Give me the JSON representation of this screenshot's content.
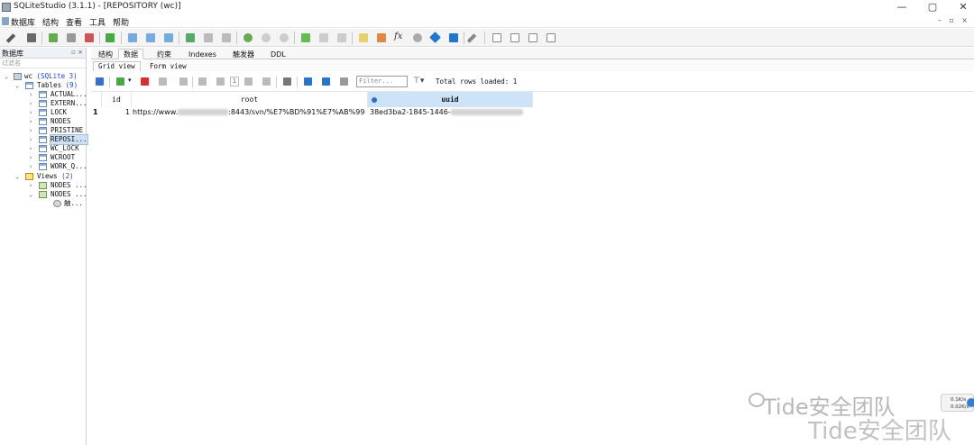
{
  "window": {
    "title": "SQLiteStudio (3.1.1) - [REPOSITORY (wc)]"
  },
  "menu": [
    "数据库",
    "结构",
    "查看",
    "工具",
    "帮助"
  ],
  "db_panel": {
    "title": "数据库",
    "filter_placeholder": "过滤名",
    "db_name": "wc",
    "db_type": "(SQLite 3)",
    "tables_label": "Tables",
    "tables_count": "(9)",
    "tables": [
      "ACTUAL...",
      "EXTERN...",
      "LOCK",
      "NODES",
      "PRISTINE",
      "REPOSI...",
      "WC_LOCK",
      "WCROOT",
      "WORK_Q..."
    ],
    "selected_table": "REPOSI...",
    "views_label": "Views",
    "views_count": "(2)",
    "views": [
      "NODES ...",
      "NODES ..."
    ],
    "trigger_label": "触..."
  },
  "tabs": [
    "结构",
    "数据",
    "约束",
    "Indexes",
    "触发器",
    "DDL"
  ],
  "active_tab": "数据",
  "subtabs": [
    "Grid view",
    "Form view"
  ],
  "active_subtab": "Grid view",
  "data_toolbar": {
    "page": "1",
    "filter_placeholder": "Filter...",
    "total_rows": "Total rows loaded: 1"
  },
  "grid": {
    "columns": [
      "id",
      "root",
      "uuid"
    ],
    "selected_column": "uuid",
    "rows": [
      {
        "rownum": "1",
        "id": "1",
        "root_prefix": "https://www.",
        "root_suffix": ":8443/svn/%E7%BD%91%E7%AB%99",
        "uuid_prefix": "38ed3ba2-1845-1446-"
      }
    ]
  },
  "watermark": "Tide安全团队",
  "net_widget": {
    "up": "0.1K/s",
    "down": "0.02K/s"
  },
  "colors": {
    "selection": "#cde3f7",
    "link": "#2244cc"
  }
}
